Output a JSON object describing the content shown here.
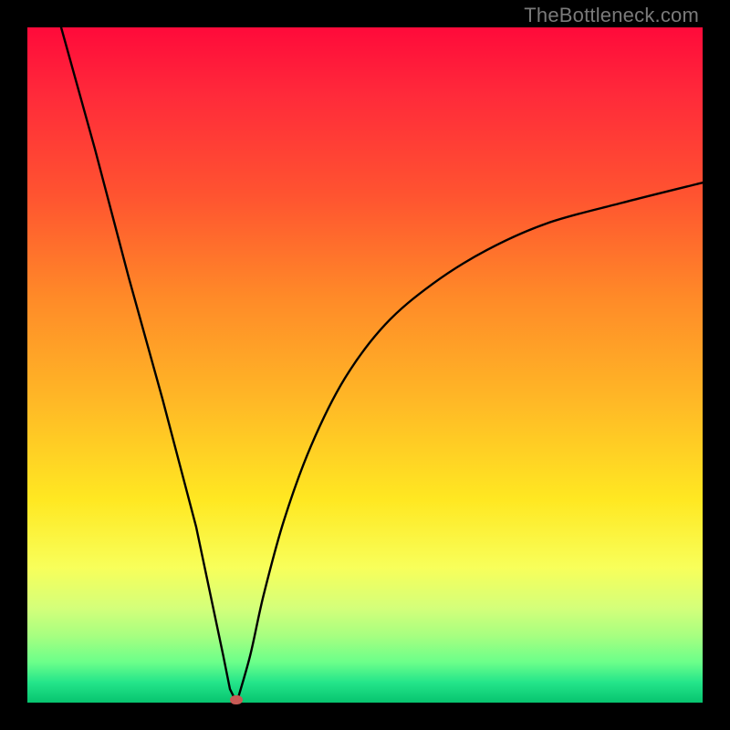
{
  "watermark": "TheBottleneck.com",
  "colors": {
    "frame": "#000000",
    "curve": "#000000",
    "marker": "#c85a55",
    "gradient_stops": [
      "#ff0a3a",
      "#ff2a3a",
      "#ff5430",
      "#ff8a28",
      "#ffb726",
      "#ffe822",
      "#f8ff5a",
      "#d4ff7a",
      "#a8ff80",
      "#6cff8a",
      "#24e58a",
      "#07c46f"
    ]
  },
  "chart_data": {
    "type": "line",
    "title": "",
    "xlabel": "",
    "ylabel": "",
    "xlim": [
      0,
      100
    ],
    "ylim": [
      0,
      100
    ],
    "grid": false,
    "marker": {
      "x": 31,
      "y": 0
    },
    "series": [
      {
        "name": "left-branch",
        "x": [
          5,
          10,
          15,
          20,
          25,
          29,
          30,
          31
        ],
        "values": [
          100,
          82,
          63,
          45,
          26,
          7,
          2,
          0
        ]
      },
      {
        "name": "right-branch",
        "x": [
          31,
          33,
          35,
          38,
          42,
          47,
          53,
          60,
          68,
          77,
          88,
          100
        ],
        "values": [
          0,
          7,
          16,
          27,
          38,
          48,
          56,
          62,
          67,
          71,
          74,
          77
        ]
      }
    ]
  }
}
